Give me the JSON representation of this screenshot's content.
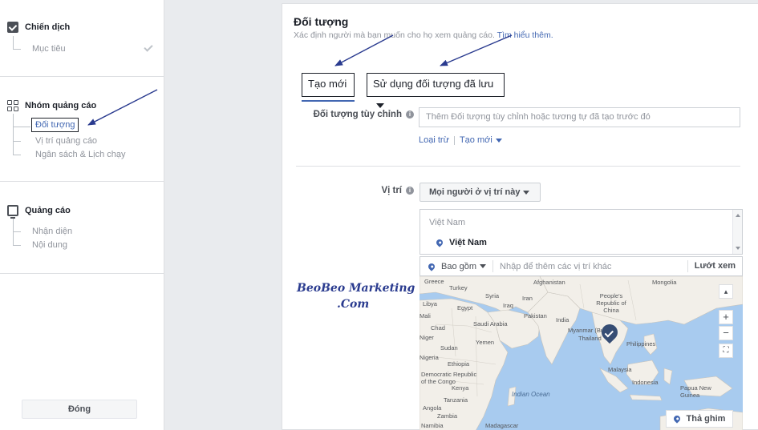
{
  "sidebar": {
    "campaign": {
      "label": "Chiến dịch",
      "items": [
        "Mục tiêu"
      ]
    },
    "adset": {
      "label": "Nhóm quảng cáo",
      "items": [
        "Đối tượng",
        "Vị trí quảng cáo",
        "Ngân sách & Lịch chạy"
      ],
      "active_index": 0
    },
    "ad": {
      "label": "Quảng cáo",
      "items": [
        "Nhận diện",
        "Nội dung"
      ]
    },
    "close_label": "Đóng"
  },
  "audience": {
    "title": "Đối tượng",
    "description": "Xác định người mà bạn muốn cho họ xem quảng cáo.",
    "learn_more": "Tìm hiểu thêm.",
    "tabs": [
      {
        "label": "Tạo mới",
        "active": true
      },
      {
        "label": "Sử dụng đối tượng đã lưu",
        "active": false
      }
    ],
    "custom_audience": {
      "label": "Đối tượng tùy chỉnh",
      "placeholder": "Thêm Đối tượng tùy chỉnh hoặc tương tự đã tạo trước đó",
      "exclude_link": "Loại trừ",
      "create_link": "Tạo mới"
    },
    "location": {
      "label": "Vị trí",
      "selector": "Mọi người ở vị trí này",
      "group_label": "Việt Nam",
      "selected_item": "Việt Nam",
      "include_label": "Bao gồm",
      "search_placeholder": "Nhập để thêm các vị trí khác",
      "browse_label": "Lướt xem",
      "pin_button": "Thả ghim"
    }
  },
  "map_labels": [
    "Greece",
    "Turkey",
    "Syria",
    "Iraq",
    "Iran",
    "Afghanistan",
    "Pakistan",
    "Egypt",
    "Saudi Arabia",
    "Yemen",
    "Sudan",
    "Ethiopia",
    "Kenya",
    "Tanzania",
    "Angola",
    "Zambia",
    "Namibia",
    "Madagascar",
    "Niger",
    "Chad",
    "Nigeria",
    "Democratic Republic of the Congo",
    "Libya",
    "Mali",
    "Mongolia",
    "People's Republic of China",
    "India",
    "Myanmar (Burma)",
    "Thailand",
    "Philippines",
    "Malaysia",
    "Indonesia",
    "Papua New Guinea",
    "Indian Ocean"
  ],
  "watermark": {
    "line1": "BeoBeo Marketing",
    "line2": ".Com"
  },
  "colors": {
    "accent": "#4267b2",
    "map_water": "#a8cbef",
    "map_land": "#f2efe9",
    "annotation": "#2a3b8f"
  }
}
